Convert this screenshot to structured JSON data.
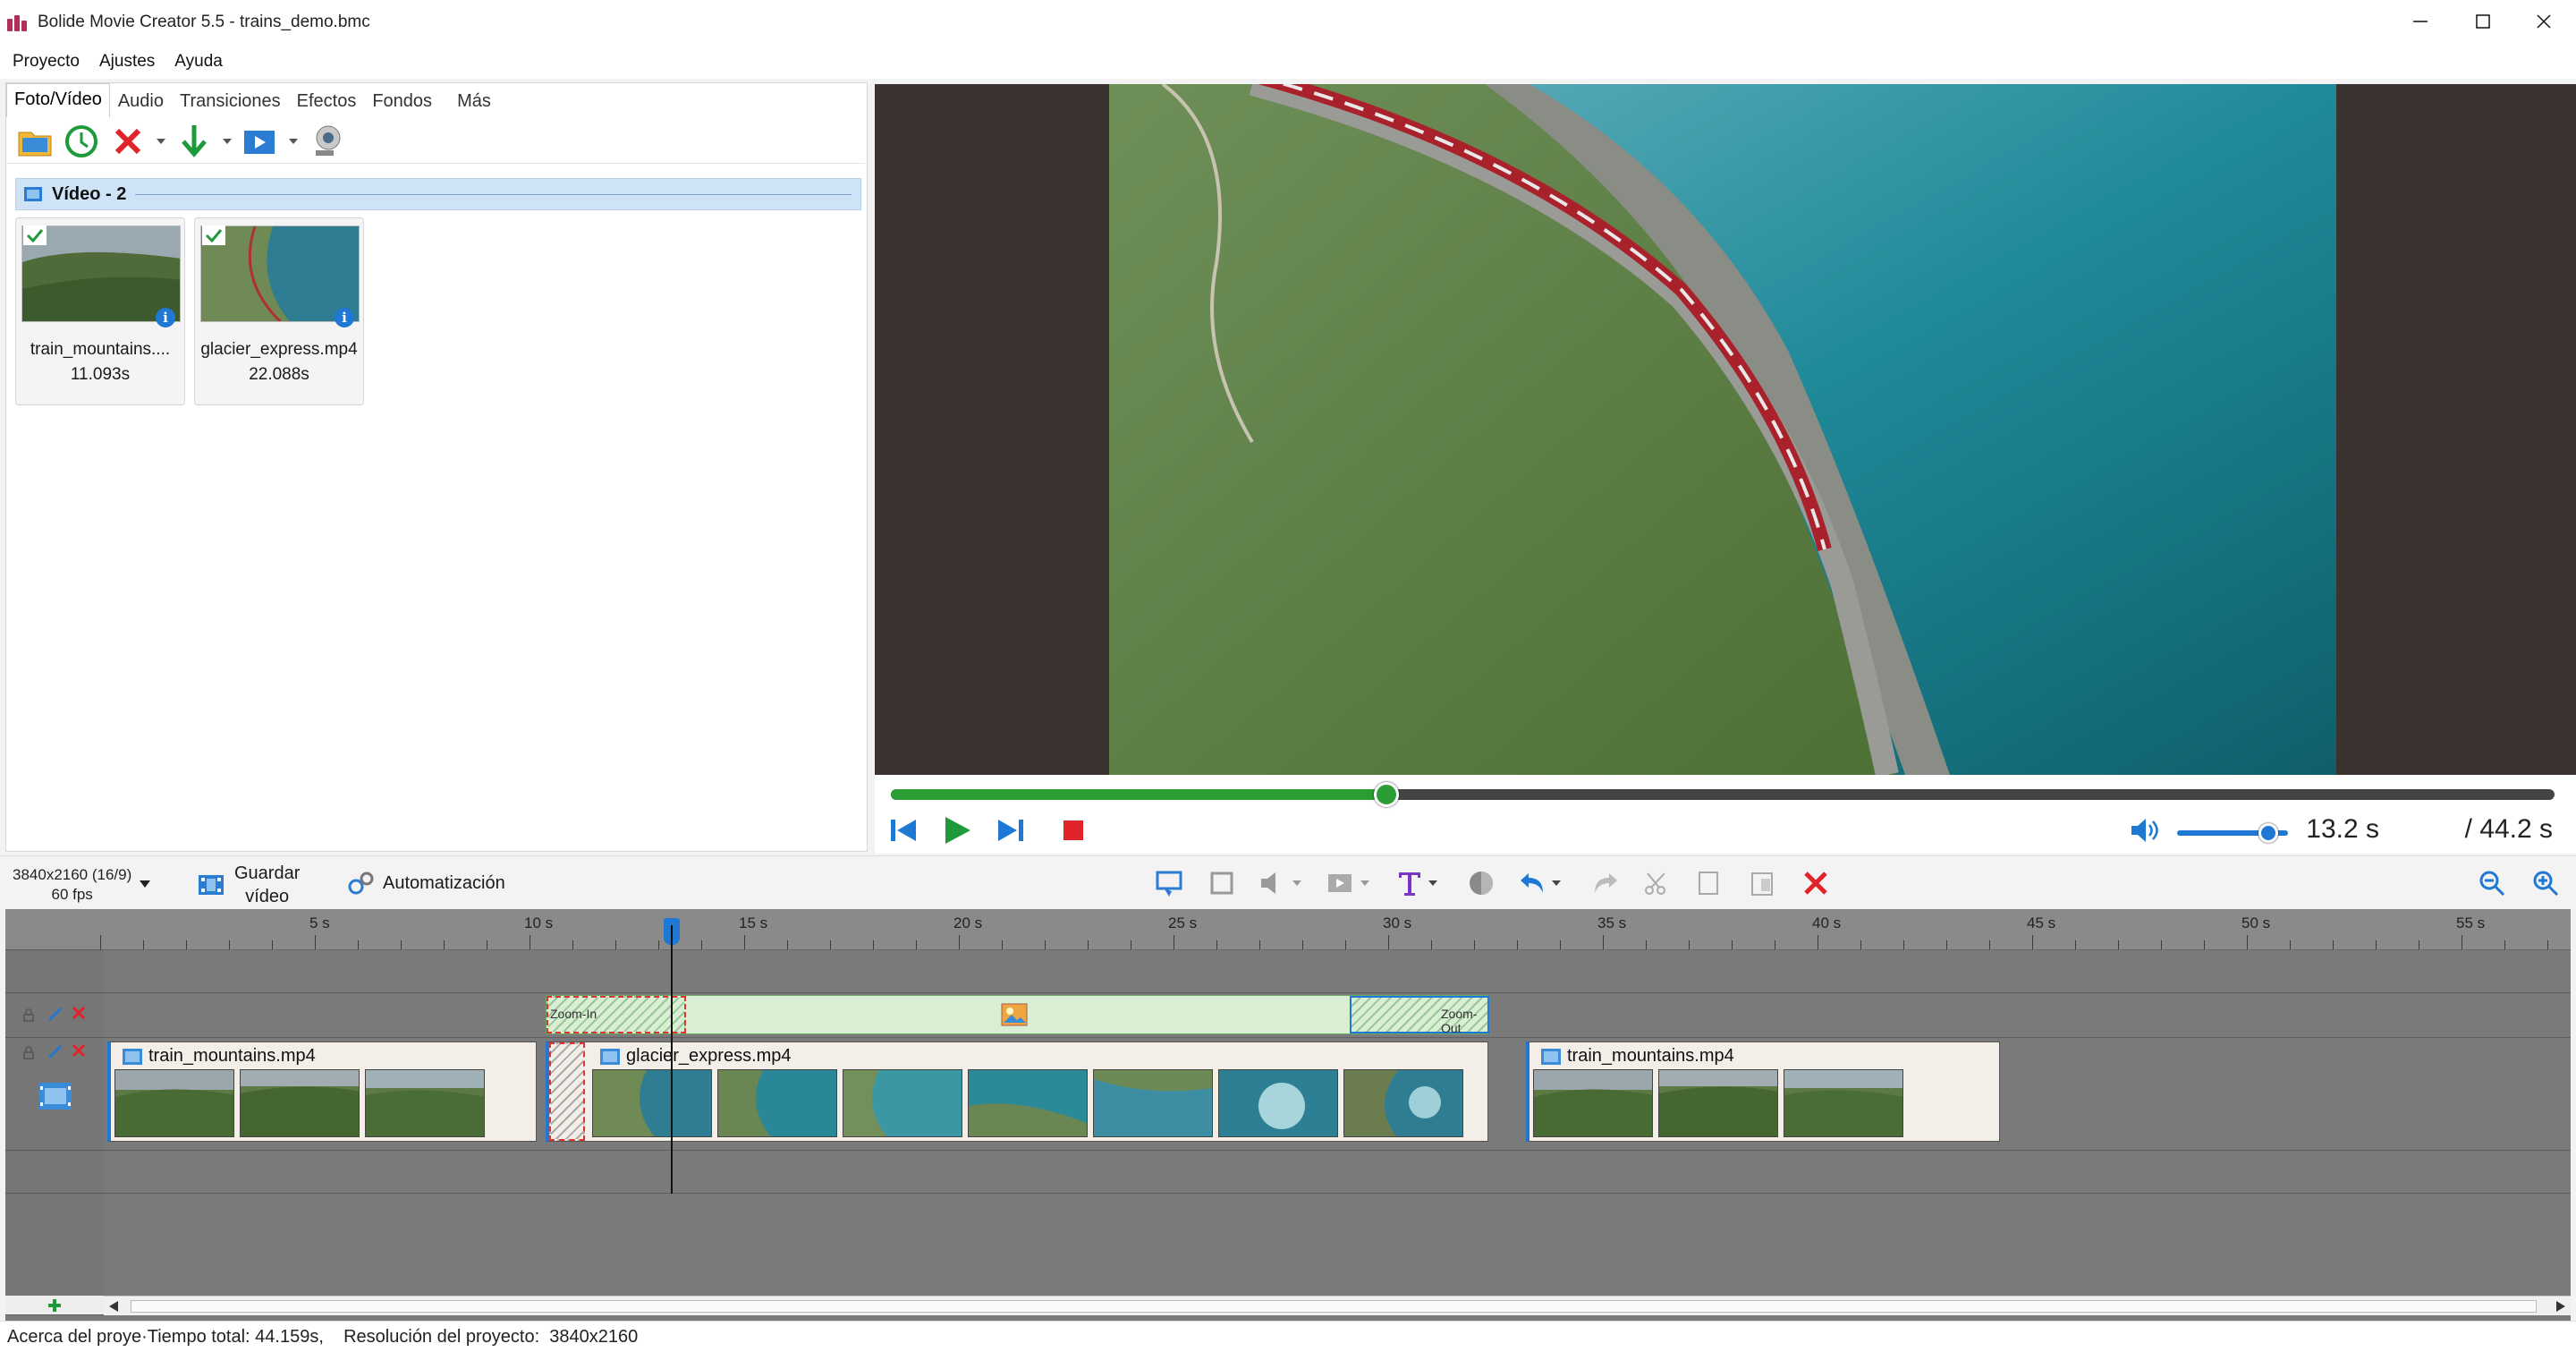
{
  "window": {
    "title": "Bolide Movie Creator 5.5 - trains_demo.bmc",
    "minimize_icon": "minimize-icon",
    "maximize_icon": "maximize-icon",
    "close_icon": "close-icon"
  },
  "menu": [
    "Proyecto",
    "Ajustes",
    "Ayuda"
  ],
  "library": {
    "tabs": [
      "Foto/Vídeo",
      "Audio",
      "Transiciones",
      "Efectos",
      "Fondos",
      "Más"
    ],
    "active_tab": "Foto/Vídeo",
    "toolbar_icons": [
      "open-folder-icon",
      "recent-clock-icon",
      "delete-icon",
      "download-icon",
      "video-capture-icon",
      "webcam-icon"
    ],
    "group_title": "Vídeo - 2",
    "items": [
      {
        "name": "train_mountains....",
        "duration": "11.093s"
      },
      {
        "name": "glacier_express.mp4",
        "duration": "22.088s"
      }
    ]
  },
  "player": {
    "progress": 0.298,
    "current_time": "13.2 s",
    "total_time": "/ 44.2 s",
    "volume": 0.82
  },
  "project": {
    "resolution": "3840x2160 (16/9)",
    "fps": "60 fps",
    "save_label_line1": "Guardar",
    "save_label_line2": "vídeo",
    "auto_label": "Automatización"
  },
  "timeline": {
    "ruler_labels": [
      "5 s",
      "10 s",
      "15 s",
      "20 s",
      "25 s",
      "30 s",
      "35 s",
      "40 s",
      "45 s",
      "50 s",
      "55 s"
    ],
    "effect_labels": {
      "zoom_in": "Zoom-In",
      "zoom_out": "Zoom-Out"
    },
    "clips": [
      {
        "name": "train_mountains.mp4"
      },
      {
        "name": "glacier_express.mp4"
      },
      {
        "name": "train_mountains.mp4"
      }
    ]
  },
  "status": {
    "text": "Acerca del proye·Tiempo total: 44.159s,    Resolución del proyecto:  3840x2160"
  },
  "colors": {
    "accent": "#1e78d4",
    "progress": "#2a9d34",
    "delete": "#e0242a"
  }
}
